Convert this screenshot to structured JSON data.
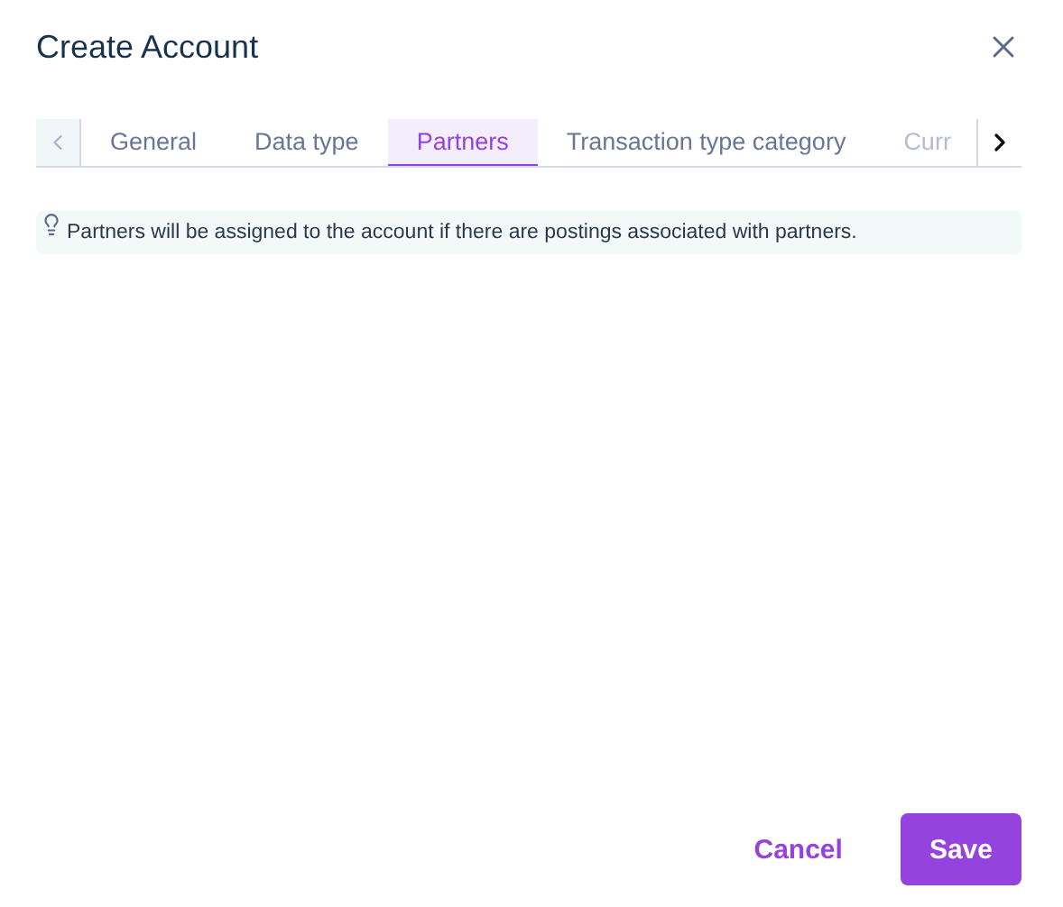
{
  "dialog": {
    "title": "Create Account"
  },
  "scroll_left": {
    "disabled": true
  },
  "scroll_right": {
    "disabled": false
  },
  "tabs": [
    {
      "label": "General",
      "selected": false
    },
    {
      "label": "Data type",
      "selected": false
    },
    {
      "label": "Partners",
      "selected": true
    },
    {
      "label": "Transaction type category",
      "selected": false
    },
    {
      "label": "Curr",
      "selected": false
    }
  ],
  "info": {
    "text": "Partners will be assigned to the account if there are postings associated with partners."
  },
  "buttons": [
    {
      "label": "Cancel",
      "kind": "text"
    },
    {
      "label": "Save",
      "kind": "primary"
    }
  ]
}
